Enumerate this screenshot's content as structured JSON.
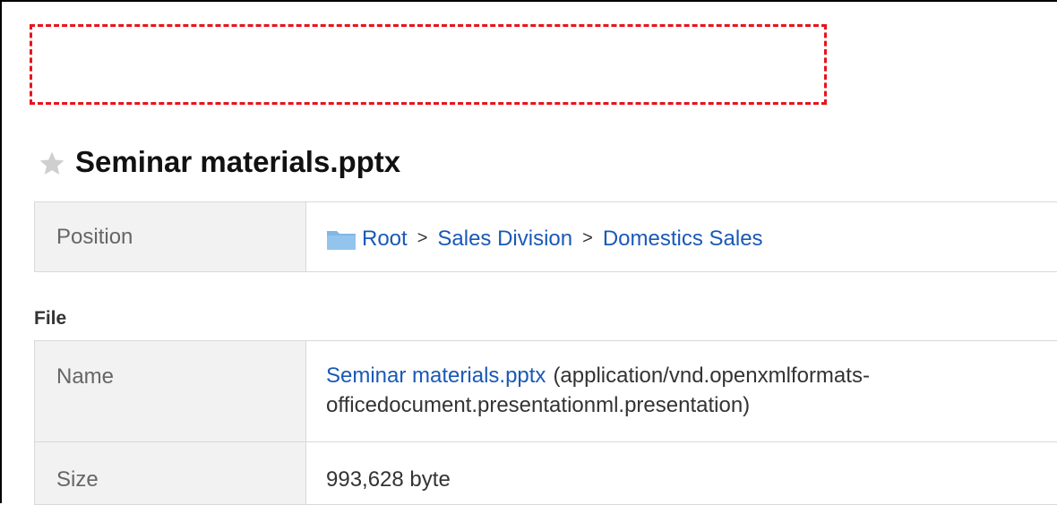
{
  "page": {
    "title": "Seminar materials.pptx"
  },
  "position": {
    "label": "Position",
    "crumbs": [
      "Root",
      "Sales Division",
      "Domestics Sales"
    ],
    "separator": ">"
  },
  "file_section": {
    "heading": "File",
    "name_label": "Name",
    "file_name": "Seminar materials.pptx",
    "mime_type": "(application/vnd.openxmlformats-officedocument.presentationml.presentation)",
    "size_label": "Size",
    "size_value": "993,628 byte"
  },
  "icons": {
    "star": "star-icon",
    "folder": "folder-icon"
  },
  "colors": {
    "highlight_dash": "#e8141c",
    "link": "#1a59b7",
    "label_background": "#f2f2f2",
    "folder": "#7fb7e6"
  }
}
